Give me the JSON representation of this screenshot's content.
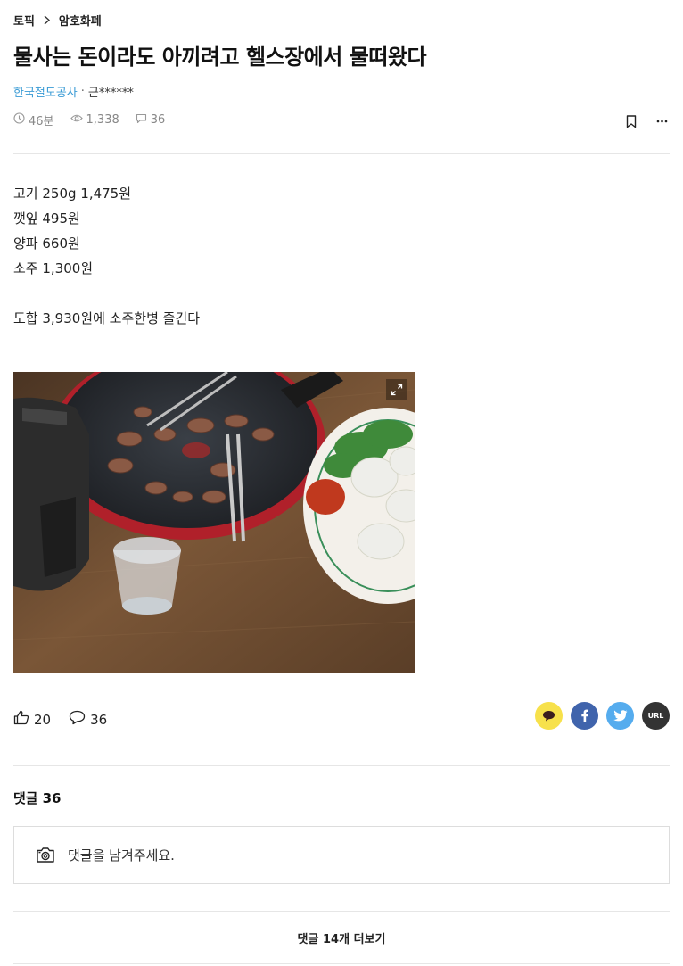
{
  "breadcrumb": {
    "items": [
      "토픽",
      "암호화폐"
    ]
  },
  "post": {
    "title": "물사는 돈이라도 아끼려고 헬스장에서 물떠왔다",
    "company": "한국철도공사",
    "separator": "·",
    "nickname": "근******",
    "time_ago": "46분",
    "views": "1,338",
    "comment_count": "36",
    "body_lines": [
      "고기 250g 1,475원",
      "깻잎 495원",
      "양파 660원",
      "소주 1,300원",
      "",
      "도합 3,930원에 소주한병 즐긴다"
    ]
  },
  "reactions": {
    "likes": "20",
    "comments": "36"
  },
  "share": {
    "url_label": "URL"
  },
  "comments": {
    "heading": "댓글",
    "count": "36",
    "input_placeholder": "댓글을 남겨주세요.",
    "more_label": "댓글 14개 더보기"
  },
  "icons": {
    "clock": "clock-icon",
    "eye": "eye-icon",
    "comment": "comment-icon",
    "bookmark": "bookmark-icon",
    "more": "more-icon",
    "thumbs_up": "thumbs-up-icon",
    "camera": "camera-icon",
    "expand": "expand-icon"
  },
  "colors": {
    "company": "#3a9bd5",
    "kakao": "#f7e14b",
    "facebook": "#4064ac",
    "twitter": "#55acee",
    "url": "#333333"
  }
}
